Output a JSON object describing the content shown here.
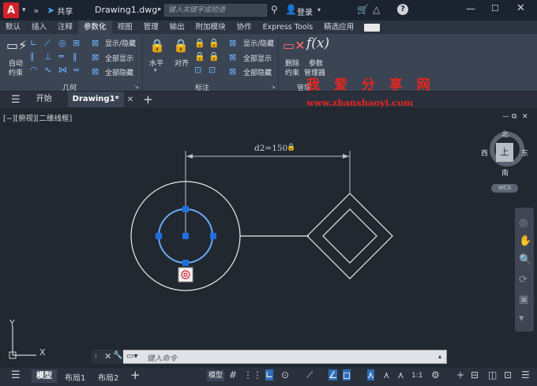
{
  "title_bar": {
    "app_letter": "A",
    "share_label": "共享",
    "document_title": "Drawing1.dwg",
    "search_placeholder": "键入关键字或短语",
    "login_label": "登录"
  },
  "ribbon_tabs": [
    "默认",
    "插入",
    "注释",
    "参数化",
    "视图",
    "管理",
    "输出",
    "附加模块",
    "协作",
    "Express Tools",
    "精选应用"
  ],
  "active_ribbon_tab": "参数化",
  "ribbon": {
    "geometry": {
      "auto_constraint_label_1": "自动",
      "auto_constraint_label_2": "约束",
      "show_hide": "显示/隐藏",
      "show_all": "全部显示",
      "hide_all": "全部隐藏",
      "panel_label": "几何"
    },
    "dimensional": {
      "horizontal": "水平",
      "aligned": "对齐",
      "show_hide": "显示/隐藏",
      "show_all": "全部显示",
      "hide_all": "全部隐藏",
      "panel_label": "标注"
    },
    "manage": {
      "delete_label_1": "删除",
      "delete_label_2": "约束",
      "params_label_1": "参数",
      "params_label_2": "管理器",
      "panel_label": "管理"
    }
  },
  "document_tabs": {
    "start": "开始",
    "active": "Drawing1*"
  },
  "viewport": {
    "label": "[−][俯视][二维线框]",
    "dimension_text": "d2=150"
  },
  "watermark": {
    "title": "我 爱 分 享 网",
    "url": "www.zhanshaoyi.com"
  },
  "viewcube": {
    "north": "北",
    "south": "南",
    "west": "西",
    "east": "东",
    "face": "上",
    "wcs": "WCS"
  },
  "ucs": {
    "x": "X",
    "y": "Y"
  },
  "command_line": {
    "placeholder": "键入命令"
  },
  "status_bar": {
    "layout_tabs": [
      "模型",
      "布局1",
      "布局2"
    ],
    "model_button": "模型",
    "scale": "1:1"
  }
}
